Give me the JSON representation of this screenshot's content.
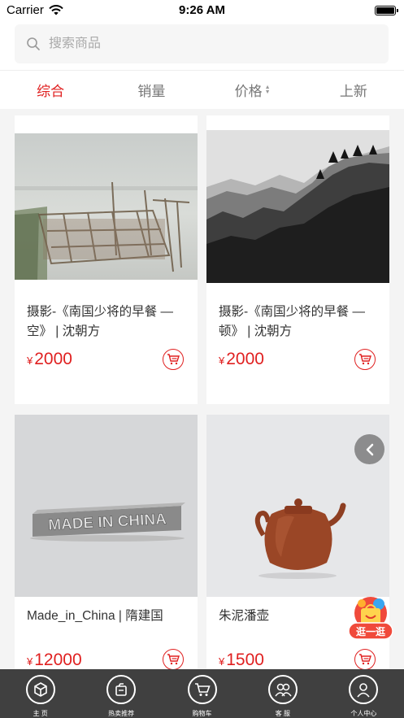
{
  "status_bar": {
    "carrier": "Carrier",
    "time": "9:26 AM"
  },
  "search": {
    "placeholder": "搜索商品"
  },
  "sort_tabs": [
    {
      "label": "综合",
      "active": true
    },
    {
      "label": "销量",
      "active": false
    },
    {
      "label": "价格",
      "active": false
    },
    {
      "label": "上新",
      "active": false
    }
  ],
  "products": [
    {
      "title": "摄影-《南国少将的早餐 — 空》 | 沈朝方",
      "currency": "¥",
      "price": "2000",
      "image": "misty-lake-bamboo-photo"
    },
    {
      "title": "摄影-《南国少将的早餐 — 顿》 | 沈朝方",
      "currency": "¥",
      "price": "2000",
      "image": "mountain-pines-bw-photo"
    },
    {
      "title": "Made_in_China | 隋建国",
      "currency": "¥",
      "price": "12000",
      "image": "made-in-china-sculpture",
      "image_text": "MADE IN CHINA"
    },
    {
      "title": "朱泥潘壶",
      "currency": "¥",
      "price": "1500",
      "image": "clay-teapot-photo"
    }
  ],
  "floating": {
    "stroll_label": "逛一逛"
  },
  "tab_bar": [
    {
      "label": "主 页",
      "icon": "home-cube-icon"
    },
    {
      "label": "热卖推荐",
      "icon": "hot-sale-icon"
    },
    {
      "label": "购物车",
      "icon": "cart-icon"
    },
    {
      "label": "客 服",
      "icon": "customer-service-icon"
    },
    {
      "label": "个人中心",
      "icon": "profile-icon"
    }
  ],
  "colors": {
    "accent": "#e02020",
    "tab_bar_bg": "#404040",
    "page_bg": "#f4f4f4"
  }
}
